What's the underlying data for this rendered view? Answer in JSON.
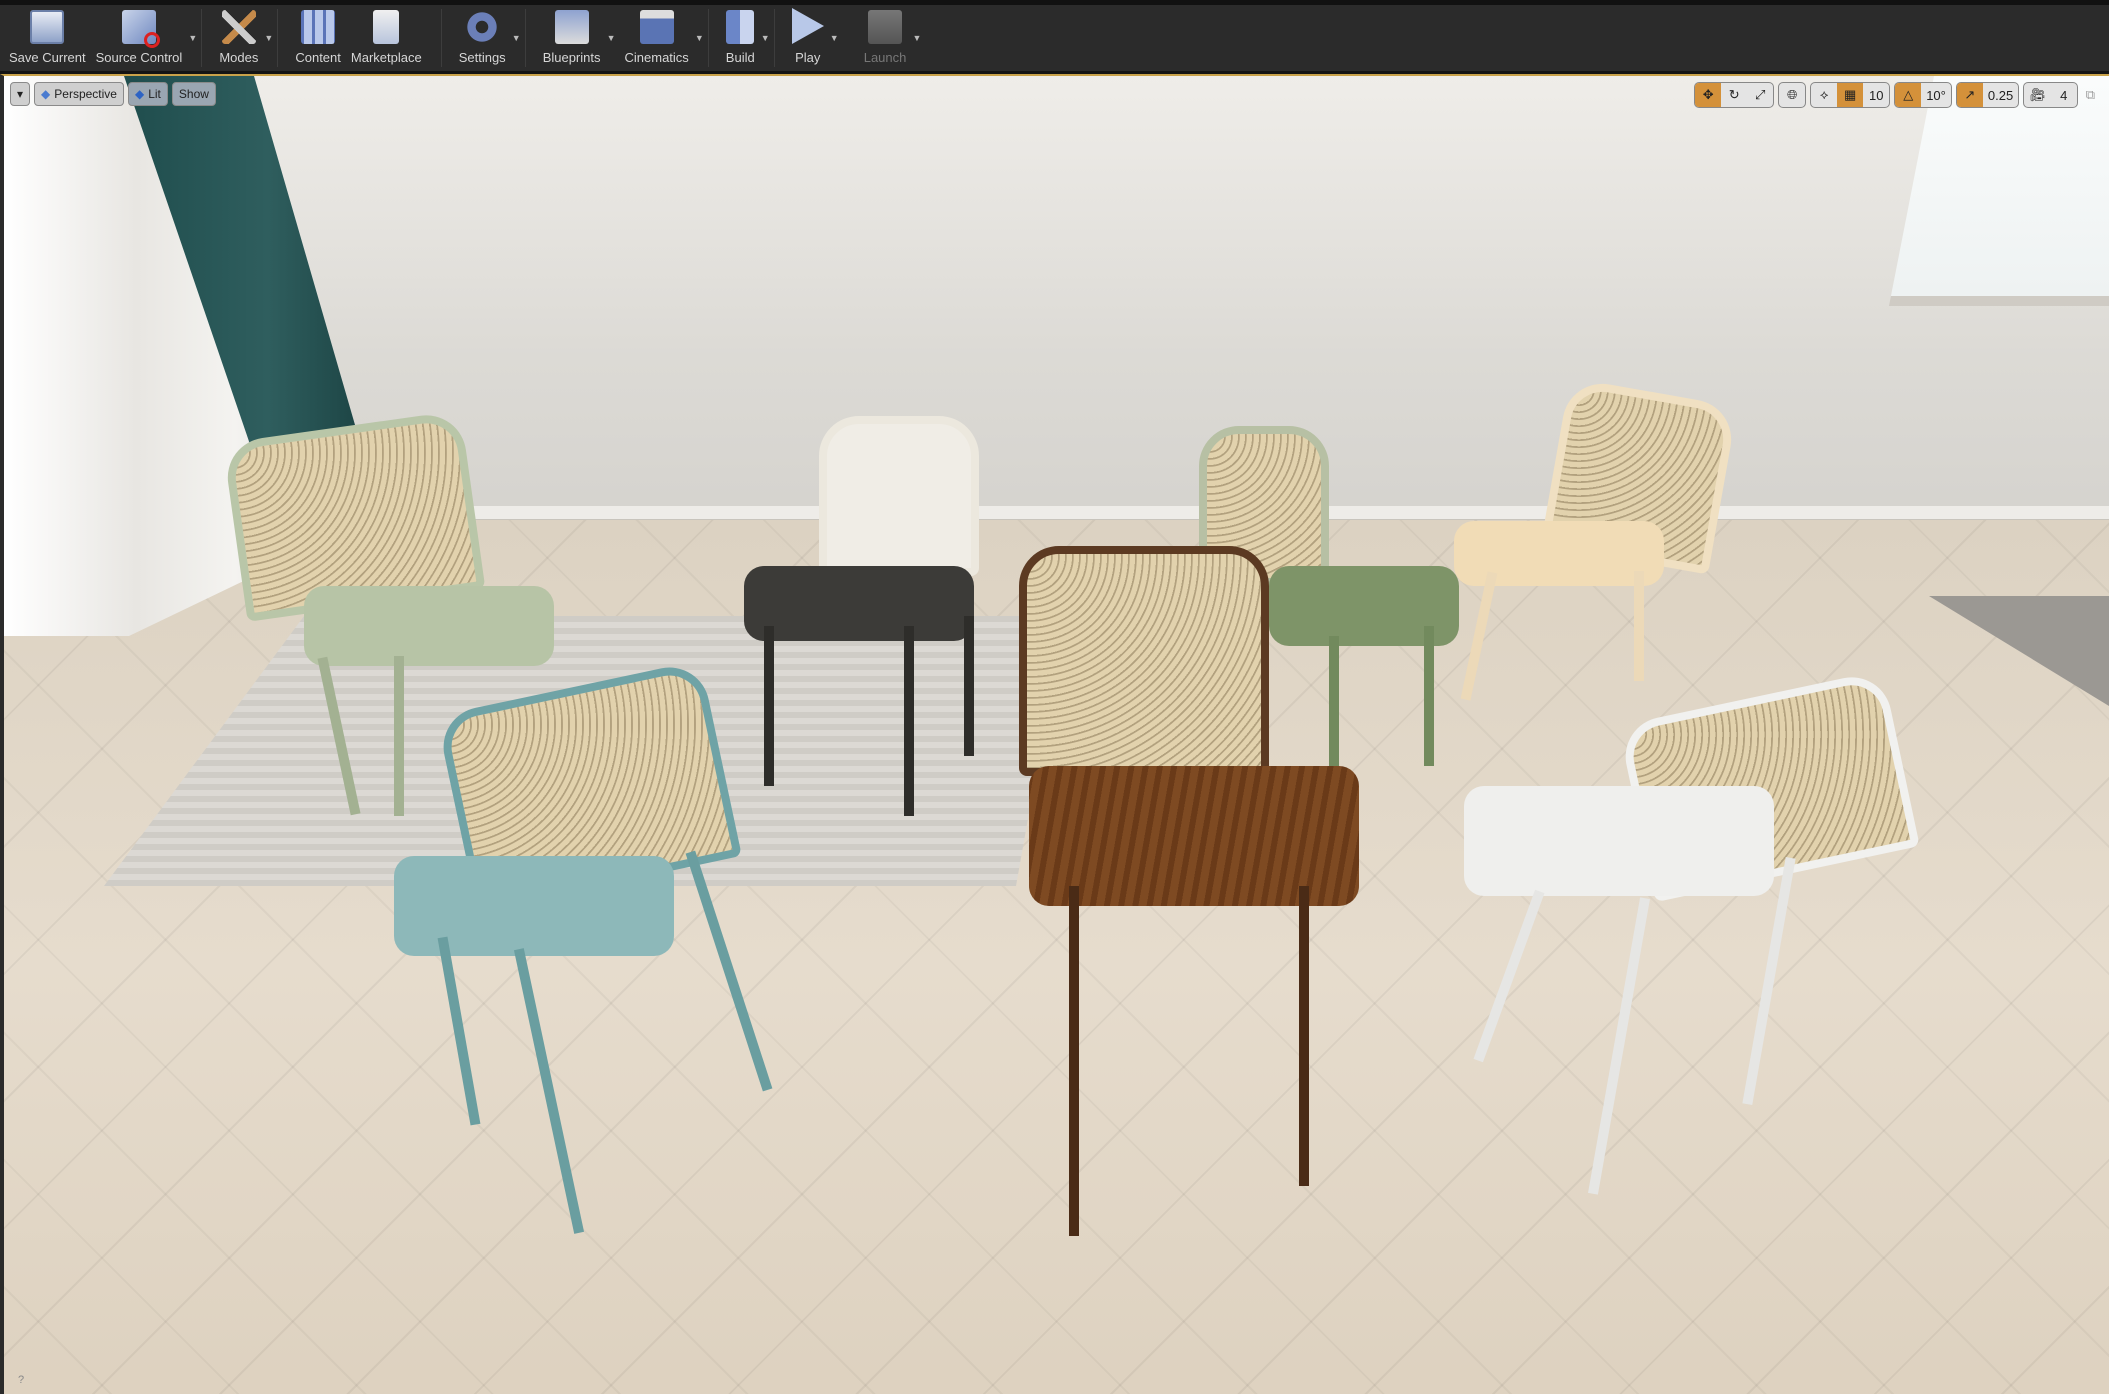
{
  "toolbar": {
    "items": [
      {
        "label": "Save Current",
        "icon": "save-icon",
        "dropdown": false
      },
      {
        "label": "Source Control",
        "icon": "source-control-icon",
        "dropdown": true
      },
      {
        "label": "Modes",
        "icon": "modes-icon",
        "dropdown": true
      },
      {
        "label": "Content",
        "icon": "content-icon",
        "dropdown": false
      },
      {
        "label": "Marketplace",
        "icon": "marketplace-icon",
        "dropdown": false
      },
      {
        "label": "Settings",
        "icon": "settings-icon",
        "dropdown": true
      },
      {
        "label": "Blueprints",
        "icon": "blueprints-icon",
        "dropdown": true
      },
      {
        "label": "Cinematics",
        "icon": "cinematics-icon",
        "dropdown": true
      },
      {
        "label": "Build",
        "icon": "build-icon",
        "dropdown": true
      },
      {
        "label": "Play",
        "icon": "play-icon",
        "dropdown": true
      },
      {
        "label": "Launch",
        "icon": "launch-icon",
        "dropdown": true
      }
    ]
  },
  "viewport": {
    "perspective_label": "Perspective",
    "lit_label": "Lit",
    "show_label": "Show",
    "grid_snap": "10",
    "rotation_snap": "10°",
    "scale_snap": "0.25",
    "camera_speed": "4",
    "help": "?"
  },
  "colors": {
    "accent": "#d4913a",
    "toolbar_bg": "#2b2b2b"
  }
}
